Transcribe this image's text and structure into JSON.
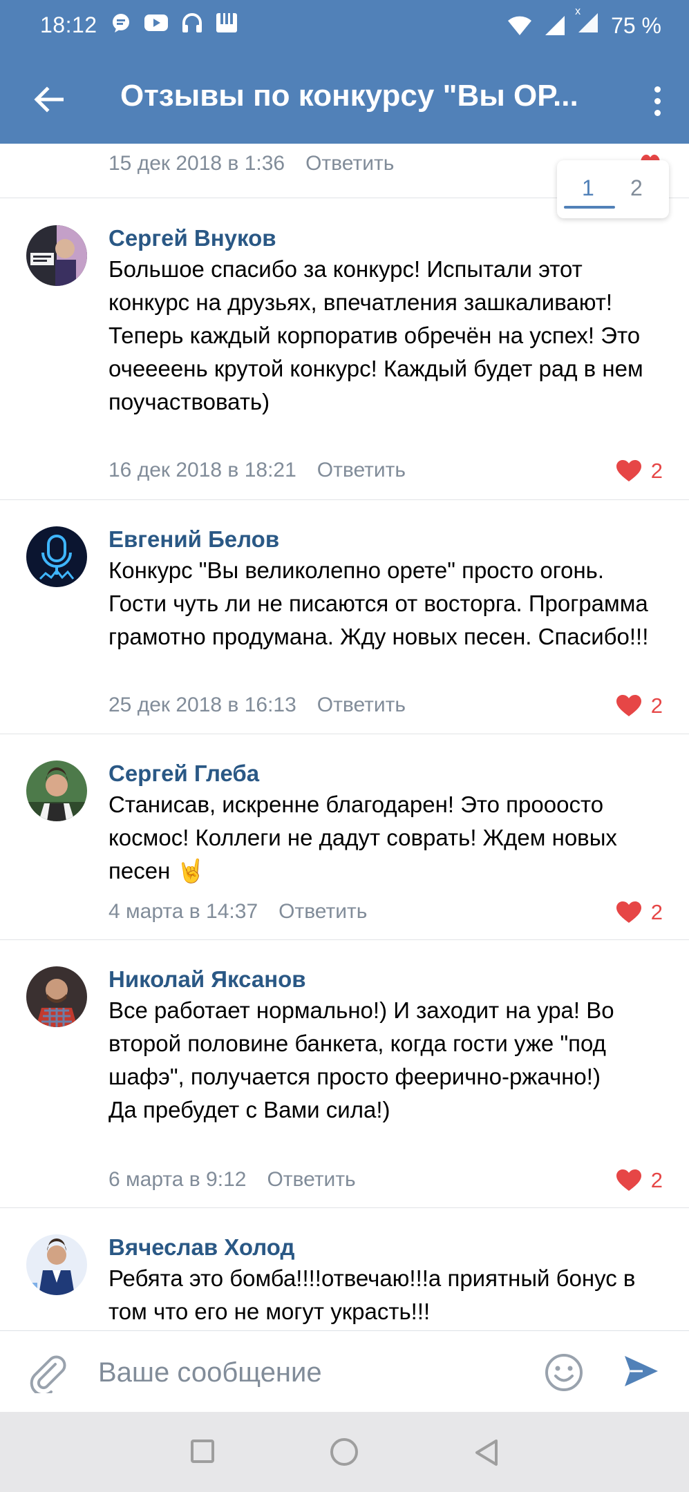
{
  "status": {
    "time": "18:12",
    "battery": "75 %",
    "x_badge": "x"
  },
  "header": {
    "title": "Отзывы по конкурсу \"Вы ОР..."
  },
  "previous_comment": {
    "date": "15 дек 2018 в 1:36",
    "reply": "Ответить"
  },
  "pager": {
    "pages": [
      "1",
      "2"
    ],
    "active": "1"
  },
  "comments": [
    {
      "author": "Сергей Внуков",
      "text": "Большое спасибо за конкурс! Испытали этот конкурс на друзьях, впечатления зашкаливают! Теперь каждый корпоратив обречён на успех! Это очеееень крутой конкурс! Каждый будет рад в нем поучаствовать)",
      "date": "16 дек 2018 в 18:21",
      "reply": "Ответить",
      "likes": "2"
    },
    {
      "author": "Евгений Белов",
      "text": "Конкурс \"Вы великолепно орете\" просто огонь. Гости чуть ли не писаются от восторга. Программа грамотно продумана. Жду новых песен. Спасибо!!!",
      "date": "25 дек 2018 в 16:13",
      "reply": "Ответить",
      "likes": "2"
    },
    {
      "author": "Сергей Глеба",
      "text": "Станисав, искренне благодарен! Это прооосто космос! Коллеги не дадут соврать! Ждем новых песен 🤘",
      "date": "4 марта в 14:37",
      "reply": "Ответить",
      "likes": "2"
    },
    {
      "author": "Николай Яксанов",
      "text": "Все работает нормально!) И заходит на ура! Во второй половине банкета, когда гости уже \"под шафэ\", получается просто феерично-ржачно!)\nДа пребудет с Вами сила!)",
      "date": "6 марта в 9:12",
      "reply": "Ответить",
      "likes": "2"
    },
    {
      "author": "Вячеслав Холод",
      "text": "Ребята это бомба!!!!отвечаю!!!а приятный бонус в том что его не могут украсть!!!"
    }
  ],
  "composer": {
    "placeholder": "Ваше сообщение"
  },
  "colors": {
    "header": "#5181b8",
    "author": "#2a5885",
    "like": "#e64646",
    "meta": "#818c99"
  }
}
